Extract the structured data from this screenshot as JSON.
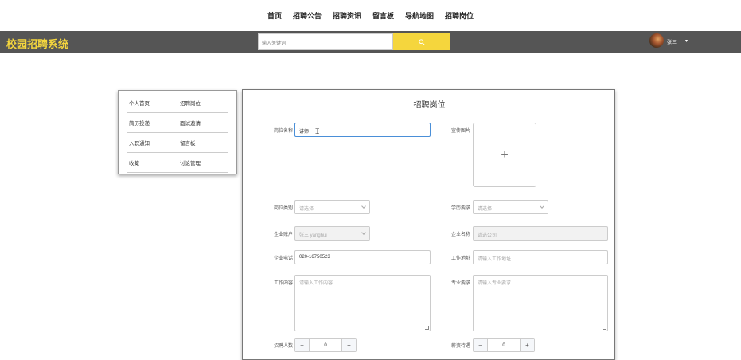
{
  "topnav": [
    "首页",
    "招聘公告",
    "招聘资讯",
    "留言板",
    "导航地图",
    "招聘岗位"
  ],
  "header": {
    "logo": "校园招聘系统",
    "search_placeholder": "输入关键词",
    "user_name": "张三",
    "user_caret": "▾"
  },
  "sidebar": [
    [
      "个人首页",
      "招聘岗位"
    ],
    [
      "简历投递",
      "面试邀请"
    ],
    [
      "入职通知",
      "留言板"
    ],
    [
      "收藏",
      "讨论管理"
    ]
  ],
  "form": {
    "title": "招聘岗位",
    "position_name": {
      "label": "岗位名称",
      "value": "讲师"
    },
    "promo_image": {
      "label": "宣传图片",
      "plus": "+"
    },
    "category": {
      "label": "岗位类别",
      "placeholder": "请选择"
    },
    "education": {
      "label": "学历要求",
      "placeholder": "请选择"
    },
    "company_account": {
      "label": "企业账户",
      "value": "张三 yanghui"
    },
    "company_name": {
      "label": "企业名称",
      "placeholder": "请选公司"
    },
    "company_phone": {
      "label": "企业电话",
      "value": "020-16750523"
    },
    "work_address": {
      "label": "工作地址",
      "placeholder": "请输入工作地址"
    },
    "work_content": {
      "label": "工作内容",
      "placeholder": "请输入工作内容"
    },
    "major_req": {
      "label": "专业要求",
      "placeholder": "请输入专业要求"
    },
    "recruit_count": {
      "label": "招聘人数",
      "value": "0",
      "minus": "−",
      "plus": "+"
    },
    "salary": {
      "label": "薪资待遇",
      "value": "0",
      "minus": "−",
      "plus": "+"
    }
  }
}
